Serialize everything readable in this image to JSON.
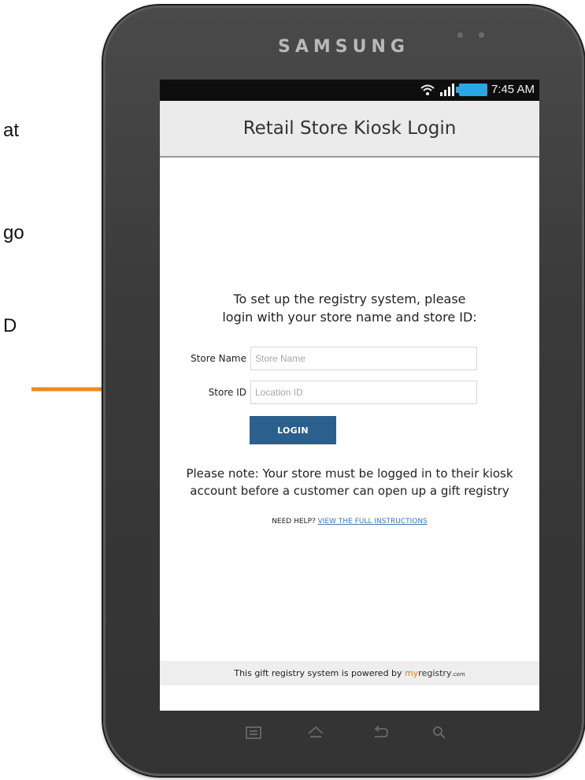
{
  "side_text": {
    "line1": "at",
    "line2": "go",
    "line3": "D"
  },
  "device": {
    "brand": "SAMSUNG"
  },
  "status_bar": {
    "time": "7:45 AM"
  },
  "app": {
    "title": "Retail Store Kiosk Login",
    "intro_line1": "To set up the registry system, please",
    "intro_line2": "login with your store name and store ID:",
    "store_name_label": "Store Name",
    "store_name_placeholder": "Store Name",
    "store_name_value": "",
    "store_id_label": "Store ID",
    "store_id_placeholder": "Location ID",
    "store_id_value": "",
    "login_label": "LOGIN",
    "note_line1": "Please note: Your store must be logged in to their kiosk",
    "note_line2": "account before a customer can open up a gift registry",
    "help_prefix": "NEED HELP?",
    "help_link": "VIEW THE FULL INSTRUCTIONS",
    "footer_text": "This gift registry system is powered by",
    "footer_brand_my": "my",
    "footer_brand_registry": "registry",
    "footer_brand_com": ".com"
  },
  "colors": {
    "arrow": "#f0891e",
    "login_button": "#2b5f8c",
    "brand_accent": "#f07a1a",
    "battery": "#2aa6e6",
    "link": "#3b78b8"
  },
  "icons": {
    "wifi": "wifi-icon",
    "signal": "signal-icon",
    "battery": "battery-icon",
    "menu": "menu-icon",
    "home": "home-icon",
    "back": "back-icon",
    "search": "search-icon"
  }
}
